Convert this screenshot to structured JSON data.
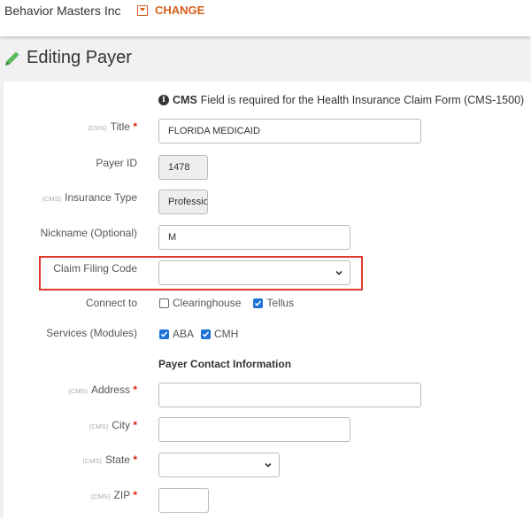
{
  "topbar": {
    "org_name": "Behavior Masters Inc",
    "change_label": "CHANGE"
  },
  "page": {
    "title": "Editing Payer"
  },
  "note": {
    "cms_bold": "CMS",
    "text": "Field is required for the Health Insurance Claim Form (CMS-1500)"
  },
  "cms_tag": "(CMS)",
  "required_mark": "*",
  "form": {
    "title": {
      "label": "Title",
      "value": "FLORIDA MEDICAID"
    },
    "payer_id": {
      "label": "Payer ID",
      "value": "1478"
    },
    "insurance_type": {
      "label": "Insurance Type",
      "value": "Professional"
    },
    "nickname": {
      "label": "Nickname (Optional)",
      "value": "M"
    },
    "claim_filing_code": {
      "label": "Claim Filing Code",
      "value": ""
    },
    "connect_to": {
      "label": "Connect to",
      "options": [
        {
          "label": "Clearinghouse",
          "checked": false
        },
        {
          "label": "Tellus",
          "checked": true
        }
      ]
    },
    "services": {
      "label": "Services (Modules)",
      "options": [
        {
          "label": "ABA",
          "checked": true
        },
        {
          "label": "CMH",
          "checked": true
        }
      ]
    },
    "contact_section_title": "Payer Contact Information",
    "address": {
      "label": "Address",
      "value": ""
    },
    "city": {
      "label": "City",
      "value": ""
    },
    "state": {
      "label": "State",
      "value": ""
    },
    "zip": {
      "label": "ZIP",
      "value": ""
    }
  },
  "colors": {
    "accent_orange": "#d9601e",
    "checkbox_blue": "#1e73d9",
    "highlight_red": "#e0392e",
    "pencil_green": "#5cb85c"
  }
}
